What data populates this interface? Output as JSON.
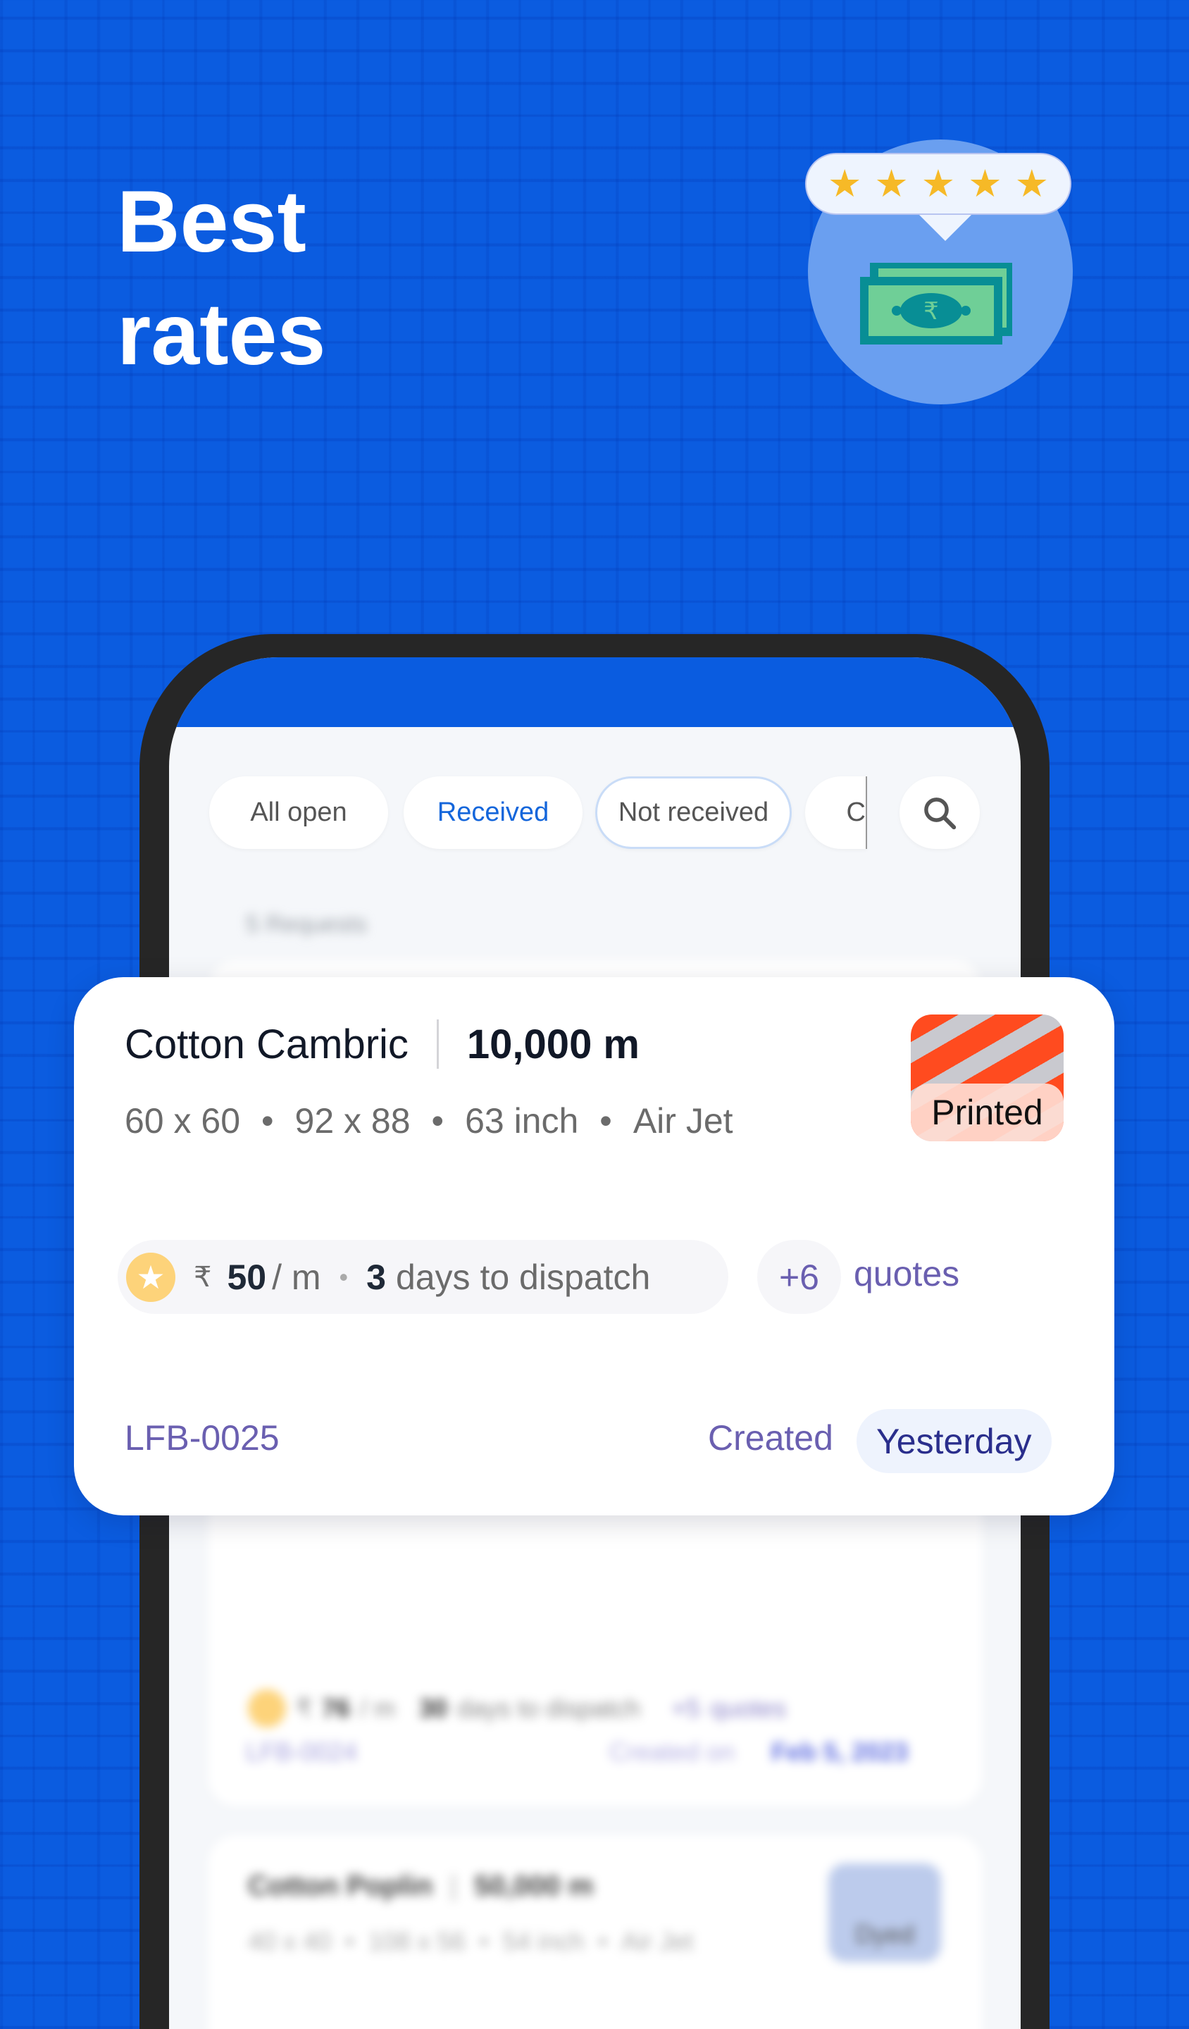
{
  "hero": {
    "line1": "Best",
    "line2": "rates"
  },
  "illustration": {
    "stars": 5,
    "icon": "rupee-cash-icon",
    "currency_symbol": "₹"
  },
  "filters": {
    "chips": [
      "All open",
      "Received",
      "Not received",
      "C"
    ],
    "active": "Received",
    "search_icon": "search-icon"
  },
  "summary": "5 Requests",
  "featured_request": {
    "fabric": "Cotton Cambric",
    "quantity": "10,000 m",
    "specs": [
      "60 x 60",
      "92 x 88",
      "63 inch",
      "Air Jet"
    ],
    "finish": "Printed",
    "price_currency": "₹",
    "price": "50",
    "price_unit": "/ m",
    "dispatch_days": "3",
    "dispatch_label": "days to dispatch",
    "extra_quotes": "+6",
    "quotes_label": "quotes",
    "code": "LFB-0025",
    "created_label": "Created",
    "created_value": "Yesterday"
  },
  "background_requests": [
    {
      "price_currency": "₹",
      "price": "76",
      "price_unit": "/ m",
      "dispatch_days": "30",
      "dispatch_label": "days to dispatch",
      "extra_quotes": "+5",
      "quotes_label": "quotes",
      "code": "LFB-0024",
      "created_label": "Created on",
      "created_value": "Feb 5, 2023"
    },
    {
      "fabric": "Cotton Poplin",
      "quantity": "50,000 m",
      "specs": [
        "40 x 40",
        "108 x 56",
        "54 inch",
        "Air Jet"
      ],
      "finish": "Dyed"
    }
  ],
  "colors": {
    "background": "#0b5ce0",
    "accent": "#1466db",
    "purple_text": "#6a5fb0",
    "star": "#f6b927"
  }
}
